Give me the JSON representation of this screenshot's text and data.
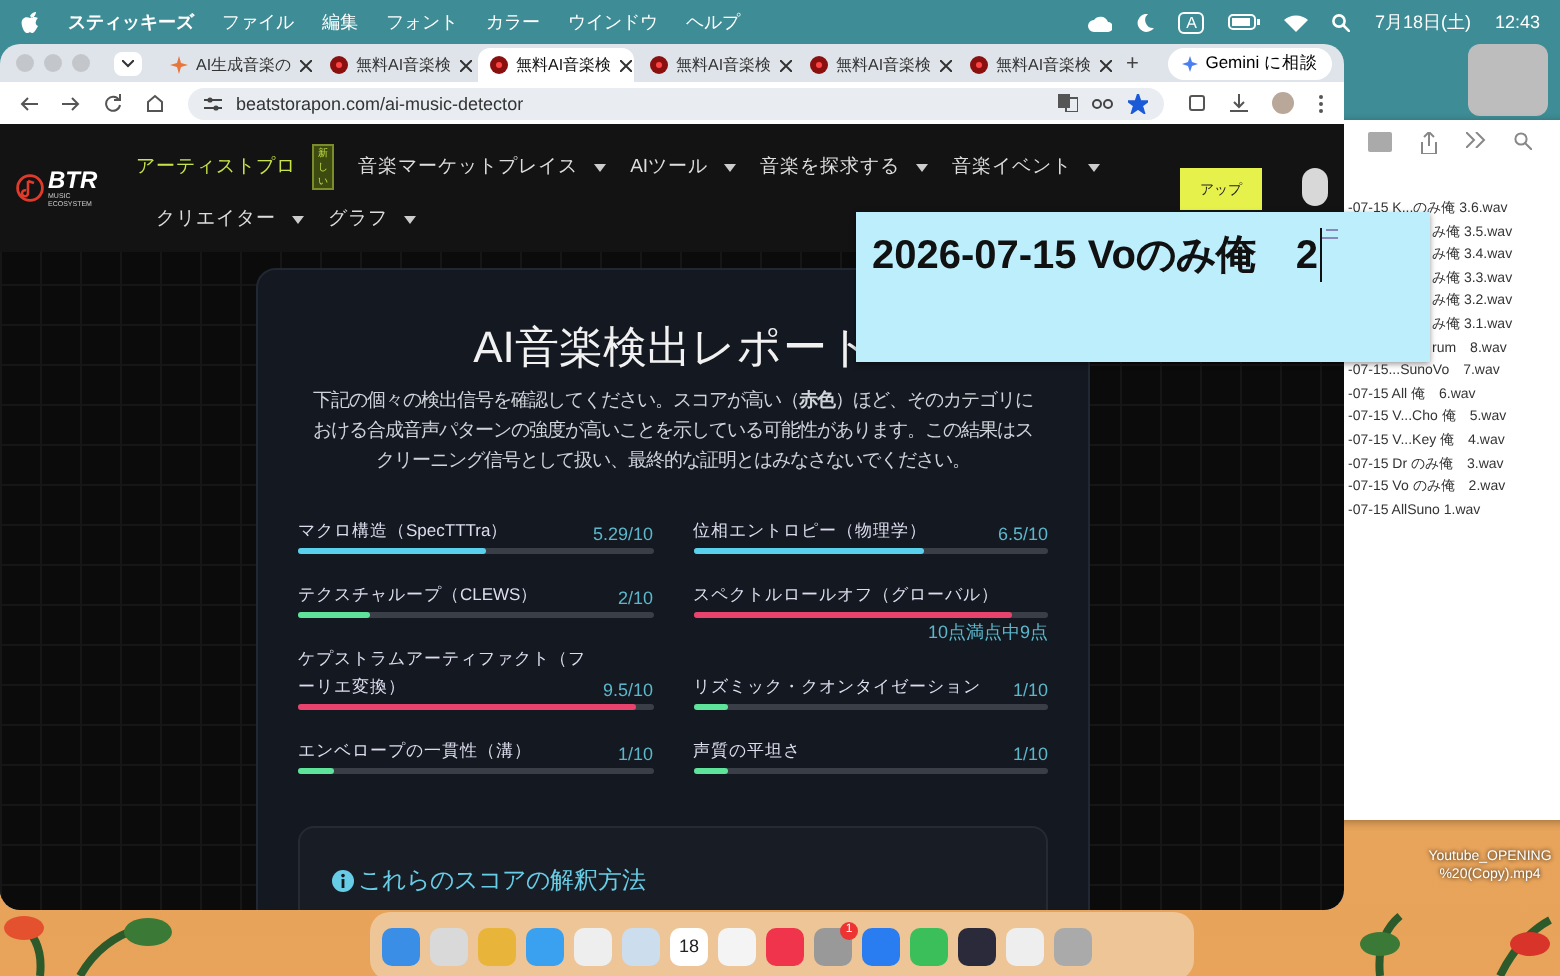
{
  "menu_bar": {
    "app_name": "スティッキーズ",
    "menus": [
      "ファイル",
      "編集",
      "フォント",
      "カラー",
      "ウインドウ",
      "ヘルプ"
    ],
    "input_source": "A",
    "date": "7月18日(土)",
    "time": "12:43"
  },
  "browser": {
    "tabs": [
      {
        "label": "AI生成音楽の",
        "selected": false,
        "kind": "sparkle"
      },
      {
        "label": "無料AI音楽検",
        "selected": false,
        "kind": "record"
      },
      {
        "label": "無料AI音楽検",
        "selected": true,
        "kind": "record"
      },
      {
        "label": "無料AI音楽検",
        "selected": false,
        "kind": "record"
      },
      {
        "label": "無料AI音楽検",
        "selected": false,
        "kind": "record"
      },
      {
        "label": "無料AI音楽検",
        "selected": false,
        "kind": "record"
      }
    ],
    "new_tab": "+",
    "gemini_button": "Gemini に相談",
    "url": "beatstorapon.com/ai-music-detector",
    "bookmarked": true
  },
  "site_header": {
    "logo_text": "BTR",
    "logo_subtext": "MUSIC ECOSYSTEM",
    "nav_rows": [
      [
        {
          "label": "アーティストプロ",
          "kind": "highlight",
          "badge": "新しい"
        },
        {
          "label": "音楽マーケットプレイス",
          "kind": "dropdown"
        },
        {
          "label": "AIツール",
          "kind": "dropdown"
        },
        {
          "label": "音楽を探求する",
          "kind": "dropdown"
        },
        {
          "label": "音楽イベント",
          "kind": "dropdown"
        }
      ],
      [
        {
          "label": "クリエイター",
          "kind": "dropdown"
        },
        {
          "label": "グラフ",
          "kind": "dropdown"
        }
      ]
    ],
    "upload_button": "アップ"
  },
  "report": {
    "title": "AI音楽検出レポート",
    "description": "下記の個々の検出信号を確認してください。スコアが高い（**赤色**）ほど、そのカテゴリにおける合成音声パターンの強度が高いことを示している可能性があります。この結果はスクリーニング信号として扱い、最終的な証明とはみなさないでください。",
    "columns": [
      {
        "items": [
          {
            "label": "マクロ構造（SpecTTTra）",
            "value": "5.29/10",
            "level": 0.529,
            "color": "#5ad1ec",
            "kind": "inline"
          },
          {
            "label": "テクスチャループ（CLEWS）",
            "value": "2/10",
            "level": 0.2,
            "color": "#5ee39a",
            "kind": "inline"
          },
          {
            "label": "ケプストラムアーティファクト（フーリエ変換）",
            "value": "9.5/10",
            "level": 0.95,
            "color": "#e8436c",
            "kind": "inline"
          },
          {
            "label": "エンベロープの一貫性（溝）",
            "value": "1/10",
            "level": 0.1,
            "color": "#5ee39a",
            "kind": "inline"
          }
        ]
      },
      {
        "items": [
          {
            "label": "位相エントロピー（物理学）",
            "value": "6.5/10",
            "level": 0.65,
            "color": "#5ad1ec",
            "kind": "inline"
          },
          {
            "label": "スペクトルロールオフ（グローバル）",
            "value": "10点満点中9点",
            "level": 0.9,
            "color": "#e8436c",
            "kind": "below"
          },
          {
            "label": "リズミック・クオンタイゼーション",
            "value": "1/10",
            "level": 0.1,
            "color": "#5ee39a",
            "kind": "inline"
          },
          {
            "label": "声質の平坦さ",
            "value": "1/10",
            "level": 0.1,
            "color": "#5ee39a",
            "kind": "inline"
          }
        ]
      }
    ],
    "info_title": "これらのスコアの解釈方法"
  },
  "sticky_note": {
    "text": "2026-07-15 Voのみ俺　2"
  },
  "finder": {
    "files": [
      {
        "name": "-07-15 K...のみ俺 3.6.wav",
        "kind": "full"
      },
      {
        "name": "み俺 3.5.wav",
        "kind": "clipped"
      },
      {
        "name": "み俺 3.4.wav",
        "kind": "clipped"
      },
      {
        "name": "み俺 3.3.wav",
        "kind": "clipped"
      },
      {
        "name": "み俺 3.2.wav",
        "kind": "clipped"
      },
      {
        "name": "み俺 3.1.wav",
        "kind": "clipped"
      },
      {
        "name": "rum　8.wav",
        "kind": "clipped"
      },
      {
        "name": "-07-15...SunoVo　7.wav",
        "kind": "full"
      },
      {
        "name": "-07-15 All 俺　6.wav",
        "kind": "full"
      },
      {
        "name": "-07-15 V...Cho 俺　5.wav",
        "kind": "full"
      },
      {
        "name": "-07-15 V...Key 俺　4.wav",
        "kind": "full"
      },
      {
        "name": "-07-15 Dr のみ俺　3.wav",
        "kind": "full"
      },
      {
        "name": "-07-15 Vo のみ俺　2.wav",
        "kind": "full"
      },
      {
        "name": "-07-15 AllSuno 1.wav",
        "kind": "full"
      }
    ]
  },
  "desktop_file": "Youtube_OPENING %20(Copy).mp4",
  "dock": {
    "calendar_day": "18",
    "badge": "1"
  }
}
